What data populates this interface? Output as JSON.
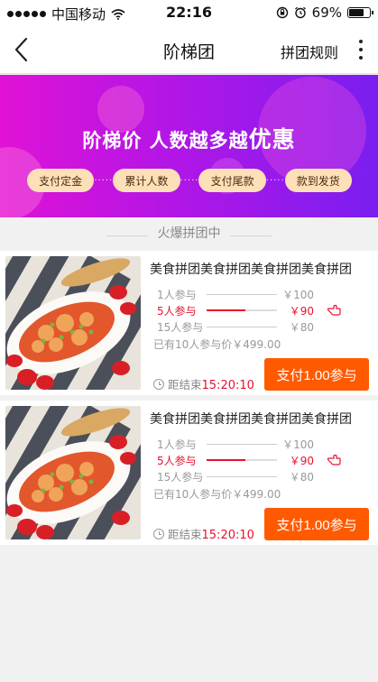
{
  "status_bar": {
    "carrier": "中国移动",
    "time": "22:16",
    "battery": "69%"
  },
  "nav": {
    "title": "阶梯团",
    "rules_label": "拼团规则"
  },
  "banner": {
    "title_part1": "阶梯价  人数越多越",
    "title_part2": "优惠",
    "steps": [
      "支付定金",
      "累计人数",
      "支付尾款",
      "款到发货"
    ],
    "connector": "·····"
  },
  "section_title": "火爆拼团中",
  "products": [
    {
      "title": "美食拼团美食拼团美食拼团美食拼团",
      "tiers": [
        {
          "label": "1人参与",
          "price": "￥100"
        },
        {
          "label": "5人参与",
          "price": "￥90"
        },
        {
          "label": "15人参与",
          "price": "￥80"
        }
      ],
      "active_tier": 1,
      "joined_text": "已有10人参与价￥499.00",
      "countdown_label": "距结束",
      "countdown_time": "15:20:10",
      "pay_label": "支付1.00参与"
    },
    {
      "title": "美食拼团美食拼团美食拼团美食拼团",
      "tiers": [
        {
          "label": "1人参与",
          "price": "￥100"
        },
        {
          "label": "5人参与",
          "price": "￥90"
        },
        {
          "label": "15人参与",
          "price": "￥80"
        }
      ],
      "active_tier": 1,
      "joined_text": "已有10人参与价￥499.00",
      "countdown_label": "距结束",
      "countdown_time": "15:20:10",
      "pay_label": "支付1.00参与"
    }
  ],
  "colors": {
    "accent": "#ff5a00",
    "highlight": "#e8112d",
    "banner_start": "#e012d6",
    "banner_end": "#7a1ef0",
    "pill": "#fde0b8"
  },
  "icons": {
    "back": "chevron-left-icon",
    "more": "more-vertical-icon",
    "clock": "clock-icon",
    "hand": "pointing-hand-icon"
  }
}
